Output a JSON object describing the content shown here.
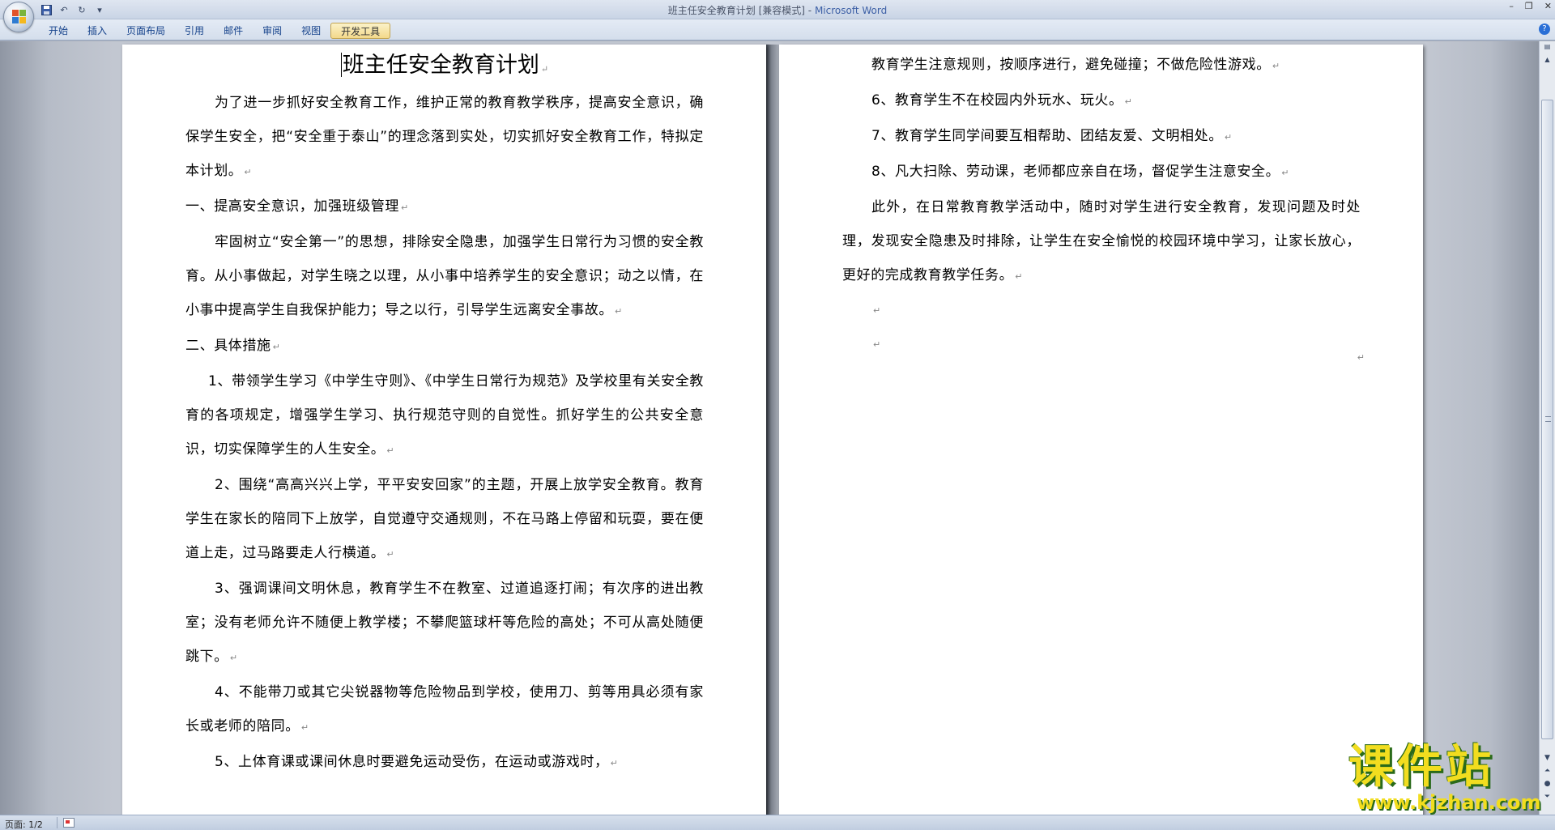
{
  "window": {
    "title": "班主任安全教育计划 [兼容模式]",
    "separator": " - ",
    "app_name": "Microsoft Word"
  },
  "ribbon": {
    "tabs": [
      "开始",
      "插入",
      "页面布局",
      "引用",
      "邮件",
      "审阅",
      "视图",
      "开发工具"
    ],
    "active_tab": "开发工具"
  },
  "document": {
    "title": "班主任安全教育计划",
    "page1": [
      "为了进一步抓好安全教育工作，维护正常的教育教学秩序，提高安全意识，确保学生安全，把“安全重于泰山”的理念落到实处，切实抓好安全教育工作，特拟定本计划。",
      "一、提高安全意识，加强班级管理",
      "牢固树立“安全第一”的思想，排除安全隐患，加强学生日常行为习惯的安全教育。从小事做起，对学生晓之以理，从小事中培养学生的安全意识；动之以情，在小事中提高学生自我保护能力；导之以行，引导学生远离安全事故。",
      "二、具体措施",
      "1、带领学生学习《中学生守则》、《中学生日常行为规范》及学校里有关安全教育的各项规定，增强学生学习、执行规范守则的自觉性。抓好学生的公共安全意识，切实保障学生的人生安全。",
      "2、围绕“高高兴兴上学，平平安安回家”的主题，开展上放学安全教育。教育学生在家长的陪同下上放学，自觉遵守交通规则，不在马路上停留和玩耍，要在便道上走，过马路要走人行横道。",
      "3、强调课间文明休息，教育学生不在教室、过道追逐打闹；有次序的进出教室；没有老师允许不随便上教学楼；不攀爬篮球杆等危险的高处；不可从高处随便跳下。",
      "4、不能带刀或其它尖锐器物等危险物品到学校，使用刀、剪等用具必须有家长或老师的陪同。",
      "5、上体育课或课间休息时要避免运动受伤，在运动或游戏时，"
    ],
    "page2": [
      "教育学生注意规则，按顺序进行，避免碰撞；不做危险性游戏。",
      "6、教育学生不在校园内外玩水、玩火。",
      "7、教育学生同学间要互相帮助、团结友爱、文明相处。",
      "8、凡大扫除、劳动课，老师都应亲自在场，督促学生注意安全。",
      "此外，在日常教育教学活动中，随时对学生进行安全教育，发现问题及时处理，发现安全隐患及时排除，让学生在安全愉悦的校园环境中学习，让家长放心，更好的完成教育教学任务。"
    ]
  },
  "statusbar": {
    "page_info": "页面: 1/2"
  },
  "watermark": {
    "cn": "课件站",
    "url": "www.kjzhan.com"
  },
  "colors": {
    "accent": "#15428b",
    "watermark_yellow": "#f2dd1f",
    "watermark_green": "#2a6a1a"
  }
}
